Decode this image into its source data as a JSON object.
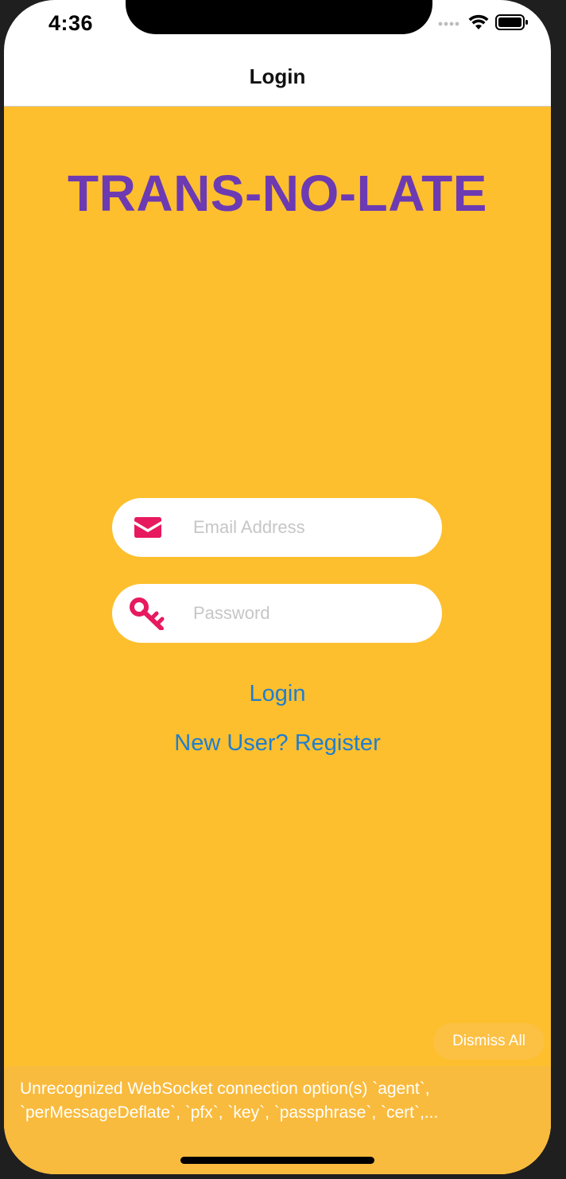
{
  "status_bar": {
    "time": "4:36"
  },
  "nav": {
    "title": "Login"
  },
  "app": {
    "title": "TRANS-NO-LATE"
  },
  "form": {
    "email_placeholder": "Email Address",
    "password_placeholder": "Password",
    "email_icon": "envelope-icon",
    "password_icon": "key-icon",
    "icon_color": "#e7195f"
  },
  "actions": {
    "login_label": "Login",
    "register_label": "New User? Register"
  },
  "toast": {
    "dismiss_label": "Dismiss All",
    "message": "Unrecognized WebSocket connection option(s) `agent`,\n`perMessageDeflate`, `pfx`, `key`, `passphrase`, `cert`,..."
  },
  "colors": {
    "background": "#fdbf2d",
    "title": "#6c3ab3",
    "link": "#1f7ed0"
  }
}
